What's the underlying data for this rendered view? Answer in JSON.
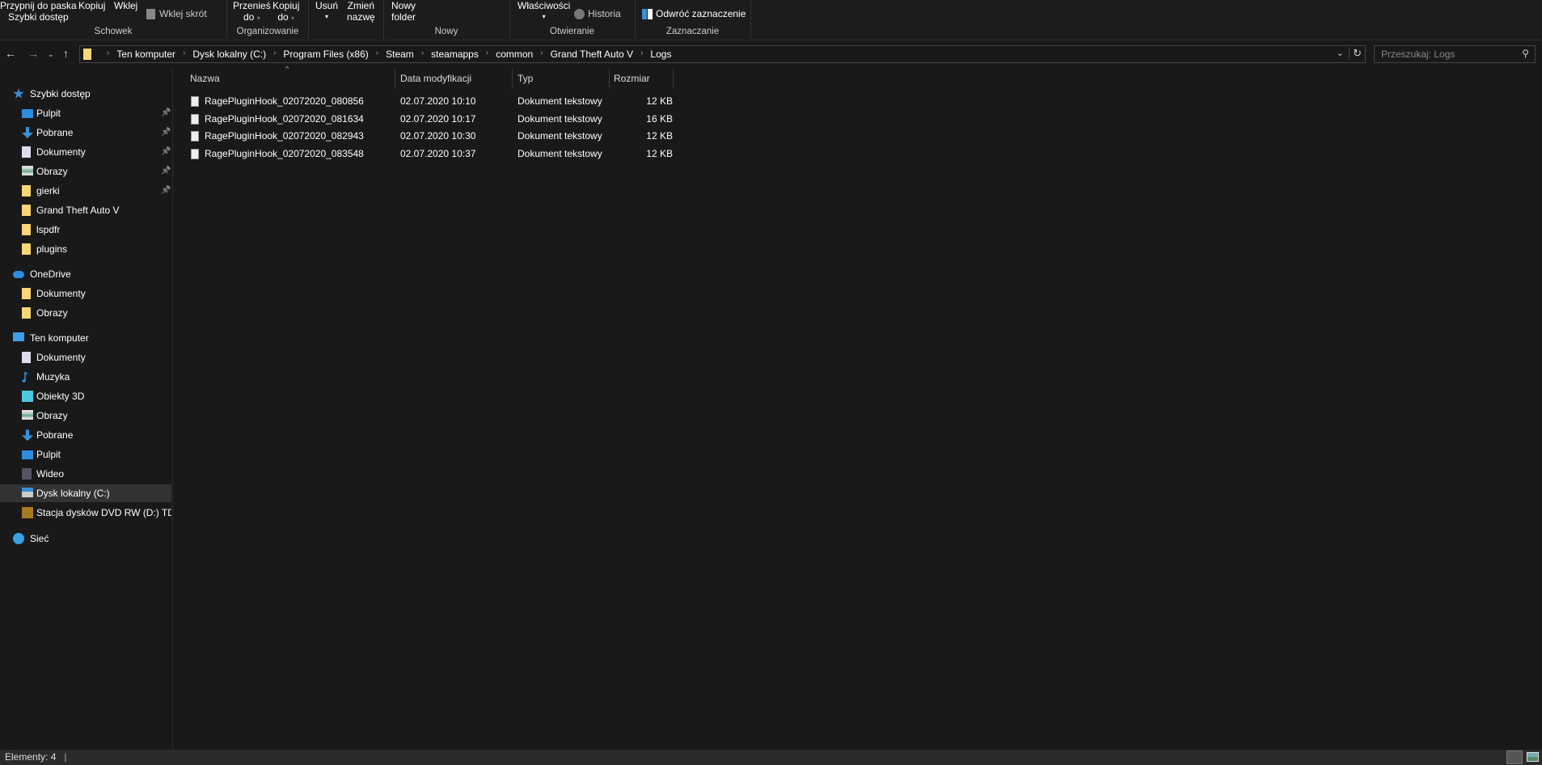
{
  "ribbon": {
    "pin": "Przypnij do paska",
    "pin2": "Szybki dostęp",
    "copy": "Kopiuj",
    "paste": "Wklej",
    "paste_shortcut": "Wklej skrót",
    "move1": "Przenieś",
    "move2": "do",
    "copyto1": "Kopiuj",
    "copyto2": "do",
    "delete": "Usuń",
    "rename1": "Zmień",
    "rename2": "nazwę",
    "newfolder1": "Nowy",
    "newfolder2": "folder",
    "properties": "Właściwości",
    "history": "Historia",
    "invert": "Odwróć zaznaczenie",
    "groups": {
      "clipboard": "Schowek",
      "organize": "Organizowanie",
      "new": "Nowy",
      "open": "Otwieranie",
      "select": "Zaznaczanie"
    }
  },
  "address": {
    "crumbs": [
      "Ten komputer",
      "Dysk lokalny (C:)",
      "Program Files (x86)",
      "Steam",
      "steamapps",
      "common",
      "Grand Theft Auto V",
      "Logs"
    ]
  },
  "search": {
    "placeholder": "Przeszukaj: Logs"
  },
  "sidebar": {
    "items": [
      {
        "label": "Szybki dostęp",
        "icon": "star-icon",
        "level": 0,
        "y": 0
      },
      {
        "label": "Pulpit",
        "icon": "desktop-icon",
        "level": 1,
        "pin": true,
        "y": 1
      },
      {
        "label": "Pobrane",
        "icon": "download-icon",
        "level": 1,
        "pin": true,
        "y": 2
      },
      {
        "label": "Dokumenty",
        "icon": "document-icon",
        "level": 1,
        "pin": true,
        "y": 3
      },
      {
        "label": "Obrazy",
        "icon": "pictures-icon",
        "level": 1,
        "pin": true,
        "y": 4
      },
      {
        "label": "gierki",
        "icon": "folder-icon",
        "level": 1,
        "pin": true,
        "y": 5
      },
      {
        "label": "Grand Theft Auto V",
        "icon": "folder-icon",
        "level": 1,
        "y": 6
      },
      {
        "label": "lspdfr",
        "icon": "folder-icon",
        "level": 1,
        "y": 7
      },
      {
        "label": "plugins",
        "icon": "folder-icon",
        "level": 1,
        "y": 8
      },
      {
        "label": "OneDrive",
        "icon": "cloud-icon",
        "level": 0,
        "y": 9.3
      },
      {
        "label": "Dokumenty",
        "icon": "folder-icon",
        "level": 1,
        "y": 10.3
      },
      {
        "label": "Obrazy",
        "icon": "folder-icon",
        "level": 1,
        "y": 11.3
      },
      {
        "label": "Ten komputer",
        "icon": "computer-icon",
        "level": 0,
        "y": 12.6
      },
      {
        "label": "Dokumenty",
        "icon": "document-icon",
        "level": 1,
        "y": 13.6
      },
      {
        "label": "Muzyka",
        "icon": "music-icon",
        "level": 1,
        "y": 14.6
      },
      {
        "label": "Obiekty 3D",
        "icon": "cube-icon",
        "level": 1,
        "y": 15.6
      },
      {
        "label": "Obrazy",
        "icon": "pictures-icon",
        "level": 1,
        "y": 16.6
      },
      {
        "label": "Pobrane",
        "icon": "download-icon",
        "level": 1,
        "y": 17.6
      },
      {
        "label": "Pulpit",
        "icon": "desktop-icon",
        "level": 1,
        "y": 18.6
      },
      {
        "label": "Wideo",
        "icon": "video-icon",
        "level": 1,
        "y": 19.6
      },
      {
        "label": "Dysk lokalny (C:)",
        "icon": "drive-icon",
        "level": 1,
        "selected": true,
        "y": 20.6
      },
      {
        "label": "Stacja dysków DVD RW (D:) TDU",
        "icon": "dvd-icon",
        "level": 1,
        "y": 21.6
      },
      {
        "label": "Sieć",
        "icon": "network-icon",
        "level": 0,
        "y": 22.9
      }
    ]
  },
  "columns": {
    "name": "Nazwa",
    "date": "Data modyfikacji",
    "type": "Typ",
    "size": "Rozmiar"
  },
  "files": [
    {
      "name": "RagePluginHook_02072020_080856",
      "date": "02.07.2020 10:10",
      "type": "Dokument tekstowy",
      "size": "12 KB"
    },
    {
      "name": "RagePluginHook_02072020_081634",
      "date": "02.07.2020 10:17",
      "type": "Dokument tekstowy",
      "size": "16 KB"
    },
    {
      "name": "RagePluginHook_02072020_082943",
      "date": "02.07.2020 10:30",
      "type": "Dokument tekstowy",
      "size": "12 KB"
    },
    {
      "name": "RagePluginHook_02072020_083548",
      "date": "02.07.2020 10:37",
      "type": "Dokument tekstowy",
      "size": "12 KB"
    }
  ],
  "status": {
    "count": "Elementy: 4"
  },
  "colors": {
    "folder": "#f8d775",
    "accent": "#1e90ff",
    "selected": "#333333"
  }
}
